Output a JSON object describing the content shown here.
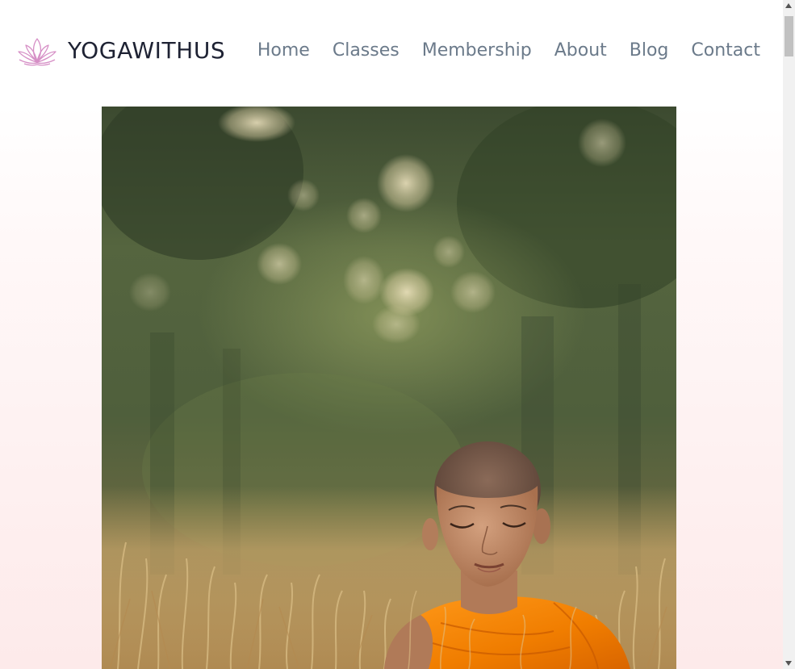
{
  "header": {
    "logo_icon": "lotus-icon",
    "brand": "YOGAWITHUS"
  },
  "nav": {
    "items": [
      {
        "label": "Home"
      },
      {
        "label": "Classes"
      },
      {
        "label": "Membership"
      },
      {
        "label": "About"
      },
      {
        "label": "Blog"
      },
      {
        "label": "Contact"
      }
    ]
  },
  "hero": {
    "image_name": "meditating-monk-photo"
  },
  "colors": {
    "brand_text": "#1e2233",
    "nav_text": "#6b7a8a",
    "logo": "#d68fc6",
    "background_tint": "#fdeaea"
  }
}
